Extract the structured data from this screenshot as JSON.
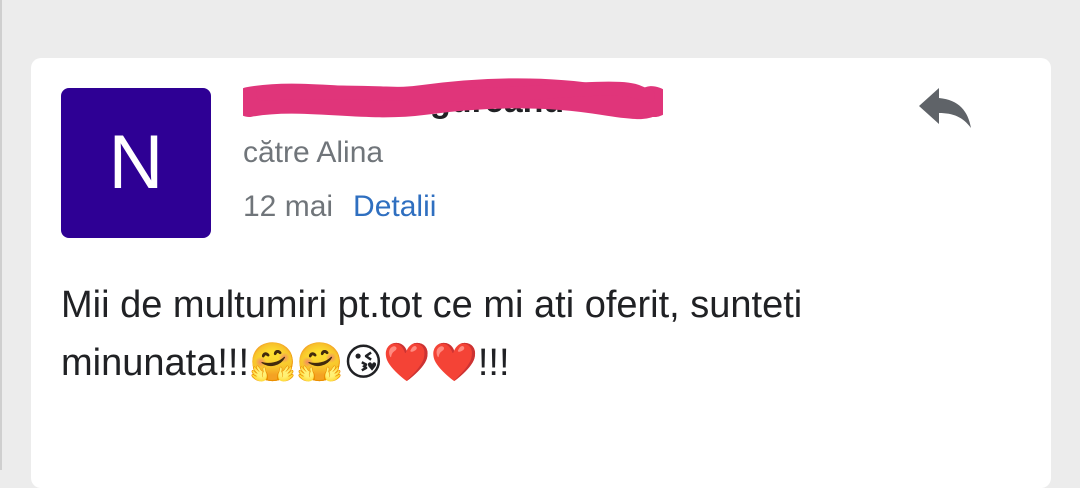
{
  "email": {
    "avatar_letter": "N",
    "sender_name": "Nicoleta Ungureanu",
    "recipient": "către Alina",
    "date": "12 mai",
    "details_label": "Detalii",
    "message_line1": "Mii de multumiri pt.tot ce mi ati oferit, sunteti",
    "message_line2": "minunata!!!🤗🤗😘❤️❤️!!!"
  },
  "icons": {
    "reply": "reply-icon"
  },
  "colors": {
    "avatar_bg": "#2e0094",
    "redaction": "#e0357a",
    "link": "#2f6fc0",
    "muted_text": "#70757a"
  }
}
